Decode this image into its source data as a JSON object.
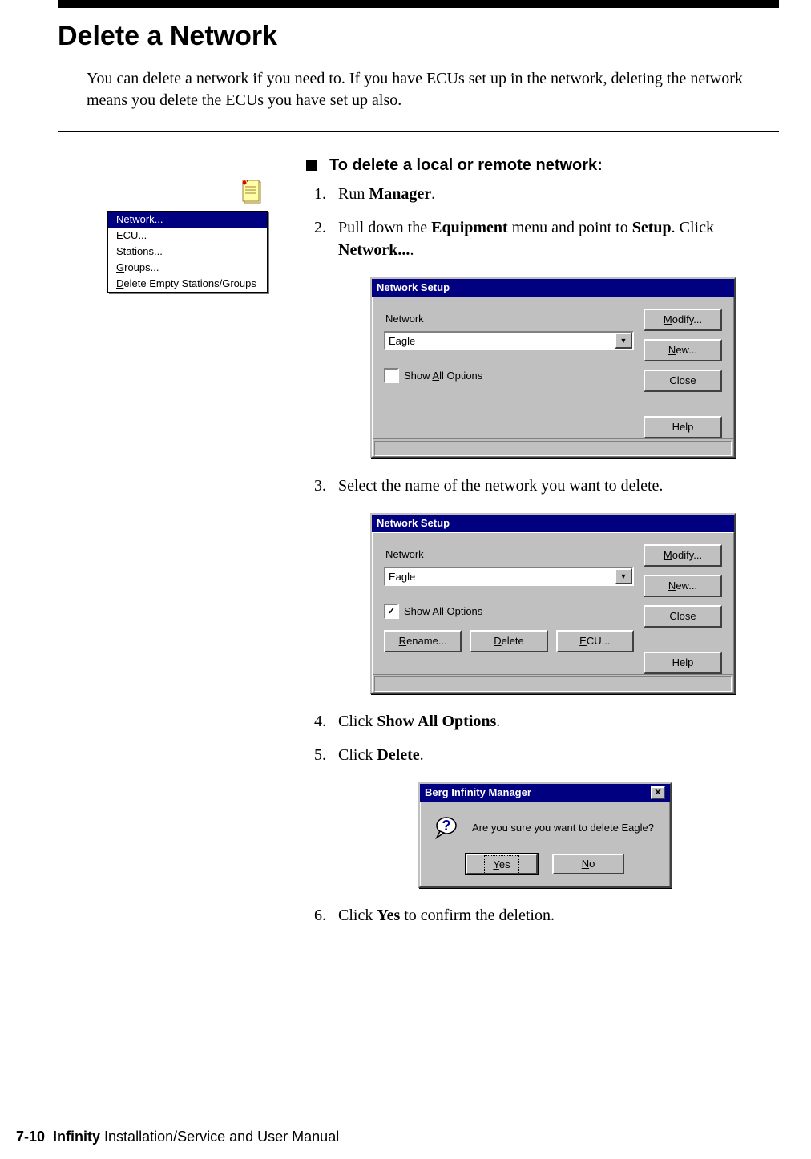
{
  "title": "Delete a Network",
  "intro": "You can delete a network if you need to. If you have ECUs set up in the network, deleting the network means you delete the ECUs you have set up also.",
  "procedure_heading": "To delete a local or remote network:",
  "steps": {
    "s1_pre": "Run ",
    "s1_b1": "Manager",
    "s1_post": ".",
    "s2_pre": "Pull down the ",
    "s2_b1": "Equipment",
    "s2_mid": " menu and point to ",
    "s2_b2": "Setup",
    "s2_mid2": ". Click ",
    "s2_b3": "Network...",
    "s2_post": ".",
    "s3": "Select the name of the network you want to delete.",
    "s4_pre": "Click ",
    "s4_b1": "Show All Options",
    "s4_post": ".",
    "s5_pre": "Click ",
    "s5_b1": "Delete",
    "s5_post": ".",
    "s6_pre": "Click ",
    "s6_b1": "Yes",
    "s6_post": " to confirm the deletion."
  },
  "context_menu": {
    "items": [
      {
        "letter": "N",
        "rest": "etwork...",
        "selected": true
      },
      {
        "letter": "E",
        "rest": "CU..."
      },
      {
        "letter": "S",
        "rest": "tations..."
      },
      {
        "letter": "G",
        "rest": "roups..."
      },
      {
        "letter": "D",
        "rest": "elete Empty Stations/Groups"
      }
    ]
  },
  "dialog_ns": {
    "title": "Network Setup",
    "network_label": "Network",
    "combo_value": "Eagle",
    "show_all_letter": "A",
    "show_all_pre": "Show ",
    "show_all_post": "ll Options",
    "buttons": {
      "modify": {
        "letter": "M",
        "rest": "odify..."
      },
      "new": {
        "letter": "N",
        "rest": "ew..."
      },
      "close": "Close",
      "help": "Help",
      "rename": {
        "letter": "R",
        "rest": "ename..."
      },
      "delete": {
        "letter": "D",
        "rest": "elete"
      },
      "ecu": {
        "letter": "E",
        "rest": "CU..."
      }
    }
  },
  "msgbox": {
    "title": "Berg Infinity Manager",
    "text": "Are you sure you want to delete Eagle?",
    "yes": {
      "letter": "Y",
      "rest": "es"
    },
    "no": {
      "letter": "N",
      "rest": "o"
    }
  },
  "footer": {
    "pageno": "7-10",
    "bold": "Infinity",
    "rest": " Installation/Service and User Manual"
  }
}
